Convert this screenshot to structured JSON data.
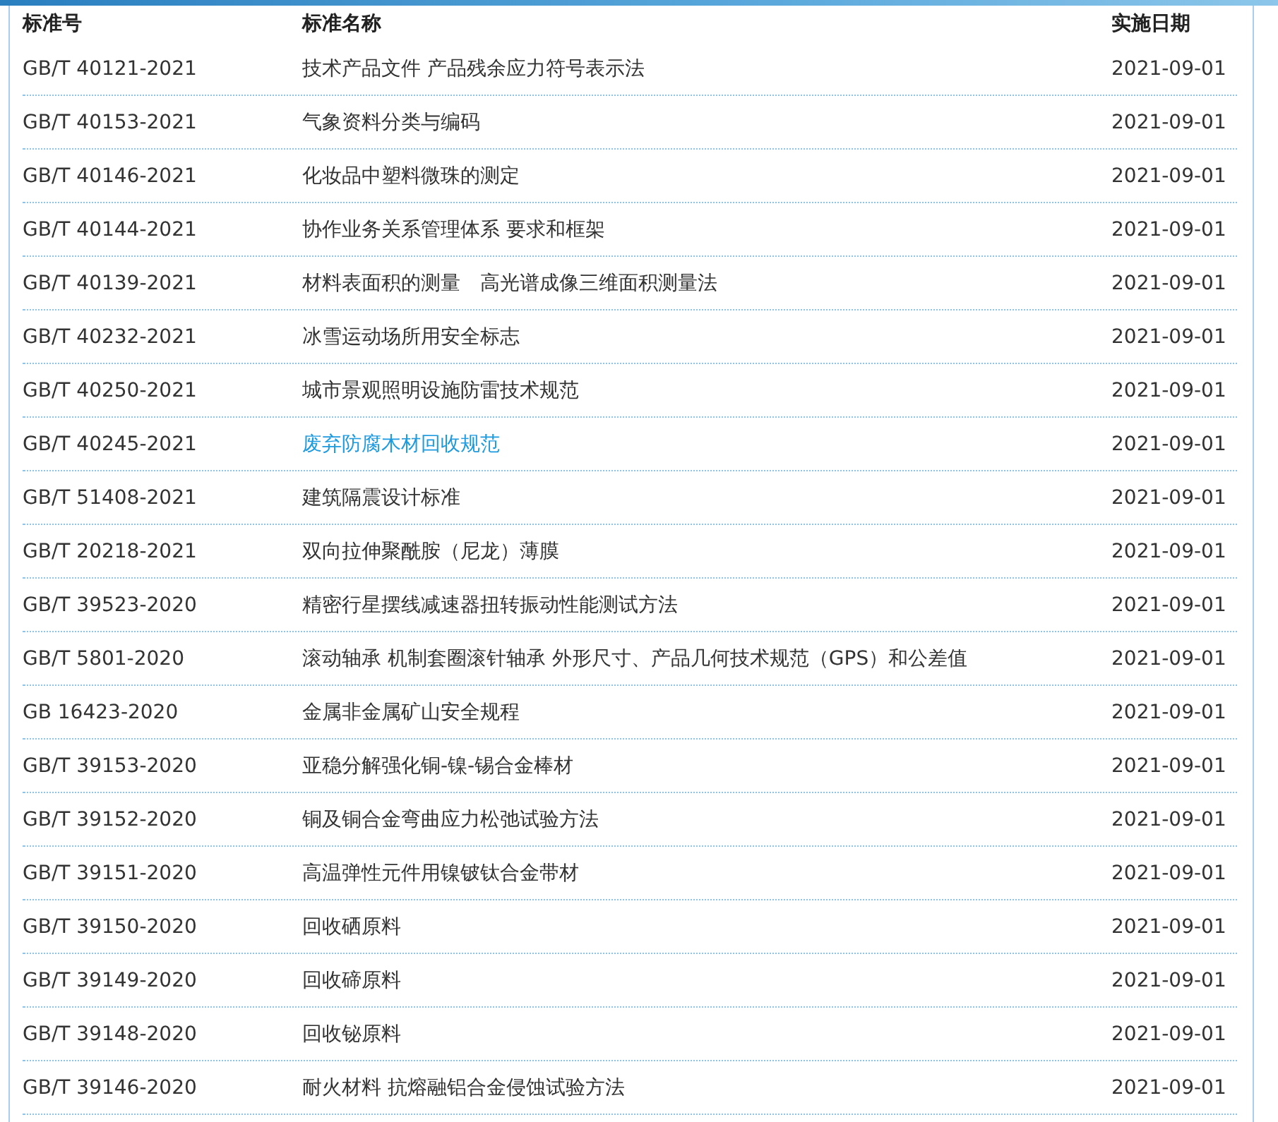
{
  "columns": [
    "标准号",
    "标准名称",
    "实施日期"
  ],
  "rows": [
    {
      "code": "GB/T 40121-2021",
      "name": "技术产品文件 产品残余应力符号表示法",
      "date": "2021-09-01",
      "hovered": false
    },
    {
      "code": "GB/T 40153-2021",
      "name": "气象资料分类与编码",
      "date": "2021-09-01",
      "hovered": false
    },
    {
      "code": "GB/T 40146-2021",
      "name": "化妆品中塑料微珠的测定",
      "date": "2021-09-01",
      "hovered": false
    },
    {
      "code": "GB/T 40144-2021",
      "name": "协作业务关系管理体系 要求和框架",
      "date": "2021-09-01",
      "hovered": false
    },
    {
      "code": "GB/T 40139-2021",
      "name": "材料表面积的测量　高光谱成像三维面积测量法",
      "date": "2021-09-01",
      "hovered": false
    },
    {
      "code": "GB/T 40232-2021",
      "name": "冰雪运动场所用安全标志",
      "date": "2021-09-01",
      "hovered": false
    },
    {
      "code": "GB/T 40250-2021",
      "name": "城市景观照明设施防雷技术规范",
      "date": "2021-09-01",
      "hovered": false
    },
    {
      "code": "GB/T 40245-2021",
      "name": "废弃防腐木材回收规范",
      "date": "2021-09-01",
      "hovered": true
    },
    {
      "code": "GB/T 51408-2021",
      "name": "建筑隔震设计标准",
      "date": "2021-09-01",
      "hovered": false
    },
    {
      "code": "GB/T 20218-2021",
      "name": "双向拉伸聚酰胺（尼龙）薄膜",
      "date": "2021-09-01",
      "hovered": false
    },
    {
      "code": "GB/T 39523-2020",
      "name": "精密行星摆线减速器扭转振动性能测试方法",
      "date": "2021-09-01",
      "hovered": false
    },
    {
      "code": "GB/T 5801-2020",
      "name": "滚动轴承 机制套圈滚针轴承 外形尺寸、产品几何技术规范（GPS）和公差值",
      "date": "2021-09-01",
      "hovered": false
    },
    {
      "code": "GB 16423-2020",
      "name": "金属非金属矿山安全规程",
      "date": "2021-09-01",
      "hovered": false
    },
    {
      "code": "GB/T 39153-2020",
      "name": "亚稳分解强化铜-镍-锡合金棒材",
      "date": "2021-09-01",
      "hovered": false
    },
    {
      "code": "GB/T 39152-2020",
      "name": "铜及铜合金弯曲应力松弛试验方法",
      "date": "2021-09-01",
      "hovered": false
    },
    {
      "code": "GB/T 39151-2020",
      "name": "高温弹性元件用镍铍钛合金带材",
      "date": "2021-09-01",
      "hovered": false
    },
    {
      "code": "GB/T 39150-2020",
      "name": "回收硒原料",
      "date": "2021-09-01",
      "hovered": false
    },
    {
      "code": "GB/T 39149-2020",
      "name": "回收碲原料",
      "date": "2021-09-01",
      "hovered": false
    },
    {
      "code": "GB/T 39148-2020",
      "name": "回收铋原料",
      "date": "2021-09-01",
      "hovered": false
    },
    {
      "code": "GB/T 39146-2020",
      "name": "耐火材料 抗熔融铝合金侵蚀试验方法",
      "date": "2021-09-01",
      "hovered": false
    }
  ]
}
